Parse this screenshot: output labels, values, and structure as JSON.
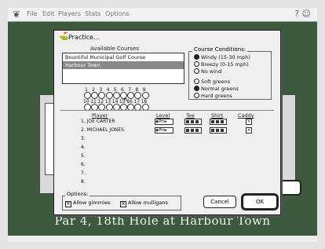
{
  "menubar": {
    "apple_icon": "apple-icon",
    "items": [
      "File",
      "Edit",
      "Players",
      "Stats",
      "Options"
    ],
    "right_icons": "? ☺"
  },
  "caption": "Par 4, 18th Hole at Harbour Town",
  "dialog": {
    "title": "Practice...",
    "available_courses_label": "Available Courses",
    "courses": [
      {
        "name": "Bountiful Municipal Golf Course",
        "selected": false
      },
      {
        "name": "Harbour Town",
        "selected": true
      }
    ],
    "conditions": {
      "title": "Course Conditions:",
      "wind": [
        {
          "label": "Windy (15-30 mph)",
          "on": true
        },
        {
          "label": "Breezy (0-15 mph)",
          "on": false
        },
        {
          "label": "No wind",
          "on": false
        }
      ],
      "greens": [
        {
          "label": "Soft greens",
          "on": false
        },
        {
          "label": "Normal greens",
          "on": true
        },
        {
          "label": "Hard greens",
          "on": false
        }
      ]
    },
    "holes_row1": [
      "1",
      "2",
      "3",
      "4",
      "5",
      "6",
      "7",
      "8",
      "9"
    ],
    "holes_row2": [
      "10",
      "11",
      "12",
      "13",
      "14",
      "15",
      "16",
      "17",
      "18"
    ],
    "columns": {
      "player": "Player",
      "level": "Level",
      "tee": "Tee",
      "shirt": "Shirt",
      "caddy": "Caddy"
    },
    "players": [
      {
        "num": "1.",
        "name": "JOE CARTER",
        "level": "Pro"
      },
      {
        "num": "2.",
        "name": "MICHAEL JONES",
        "level": "Pro"
      },
      {
        "num": "3.",
        "name": "",
        "level": ""
      },
      {
        "num": "4.",
        "name": "",
        "level": ""
      },
      {
        "num": "5.",
        "name": "",
        "level": ""
      },
      {
        "num": "6.",
        "name": "",
        "level": ""
      },
      {
        "num": "7.",
        "name": "",
        "level": ""
      },
      {
        "num": "8.",
        "name": "",
        "level": ""
      }
    ],
    "options_label": "Options:",
    "allow_gimmies": "Allow gimmies",
    "allow_mulligans": "Allow mulligans",
    "cancel_label": "Cancel",
    "ok_label": "OK"
  }
}
